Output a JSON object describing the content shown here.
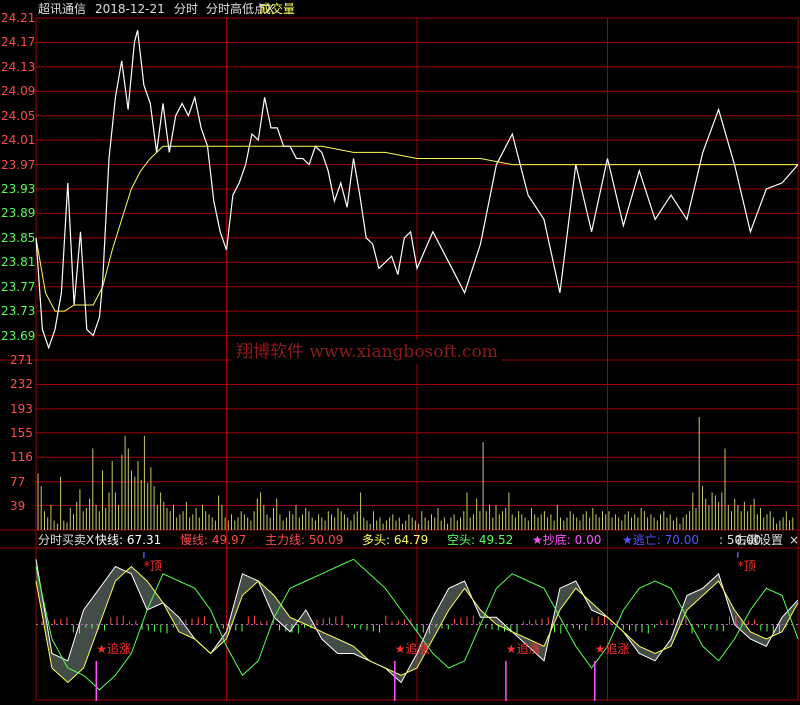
{
  "header": {
    "stock_name": "超讯通信",
    "date": "2018-12-21",
    "mode": "分时",
    "indicator": "分时高低点X",
    "volume_label": "成交量"
  },
  "watermark": "翔博软件 www.xiangbosoft.com",
  "indicator_bar": {
    "name": "分时买卖X",
    "items": [
      {
        "label": "快线:",
        "value": "67.31",
        "color": "#ffffff"
      },
      {
        "label": "慢线:",
        "value": "49.97",
        "color": "#ff4a4a"
      },
      {
        "label": "主力线:",
        "value": "50.09",
        "color": "#ff4a4a"
      },
      {
        "label": "多头:",
        "value": "64.79",
        "color": "#ffff54"
      },
      {
        "label": "空头:",
        "value": "49.52",
        "color": "#54ff54"
      },
      {
        "label": "★抄底:",
        "value": "0.00",
        "color": "#ff54ff"
      },
      {
        "label": "★逃亡:",
        "value": "70.00",
        "color": "#5454ff"
      },
      {
        "label": ":",
        "value": "50.00",
        "color": "#e0e0e0"
      }
    ],
    "settings_label": "右键设置",
    "close_label": "×"
  },
  "colors": {
    "grid": "#a00000",
    "price_line": "#ffffff",
    "avg_line": "#ffff54",
    "volume": "#c8c864",
    "up_label": "#ff4a4a",
    "down_label": "#54ff54",
    "signal_text": "#ff3030"
  },
  "chart_data": [
    {
      "type": "line",
      "panel": "price",
      "y_ticks": [
        "24.21",
        "24.17",
        "24.13",
        "24.09",
        "24.05",
        "24.01",
        "23.97",
        "23.93",
        "23.89",
        "23.85",
        "23.81",
        "23.77",
        "23.73",
        "23.69"
      ],
      "ylim": [
        23.65,
        24.21
      ],
      "series": [
        {
          "x": [
            0,
            2,
            4,
            6,
            8,
            10,
            12,
            14,
            16,
            18,
            20,
            21,
            23,
            25,
            27,
            29,
            31,
            32,
            34,
            36,
            38,
            40,
            42,
            44,
            46,
            48,
            50,
            52,
            54,
            56,
            58,
            60,
            62,
            64,
            66,
            68,
            70,
            72,
            74,
            76,
            78,
            80,
            82,
            84,
            86,
            88,
            90,
            92,
            94,
            96,
            98,
            100,
            102,
            104,
            106,
            108,
            110,
            112,
            114,
            116,
            118,
            120,
            125,
            130,
            135,
            140,
            145,
            150,
            155,
            160,
            165,
            170,
            175,
            180,
            185,
            190,
            195,
            200,
            205,
            210,
            215,
            220,
            225,
            230,
            235,
            240
          ],
          "values": [
            23.85,
            23.7,
            23.67,
            23.7,
            23.76,
            23.94,
            23.74,
            23.86,
            23.7,
            23.69,
            23.72,
            23.78,
            23.98,
            24.08,
            24.14,
            24.06,
            24.17,
            24.19,
            24.1,
            24.07,
            23.99,
            24.07,
            23.99,
            24.05,
            24.07,
            24.05,
            24.08,
            24.03,
            24.0,
            23.91,
            23.86,
            23.83,
            23.92,
            23.94,
            23.97,
            24.02,
            24.01,
            24.08,
            24.03,
            24.03,
            24.0,
            24.0,
            23.98,
            23.98,
            23.97,
            24.0,
            23.99,
            23.96,
            23.91,
            23.94,
            23.9,
            23.98,
            23.92,
            23.85,
            23.84,
            23.8,
            23.81,
            23.82,
            23.79,
            23.85,
            23.86,
            23.8,
            23.86,
            23.81,
            23.76,
            23.84,
            23.97,
            24.02,
            23.92,
            23.88,
            23.76,
            23.97,
            23.86,
            23.98,
            23.87,
            23.96,
            23.88,
            23.92,
            23.88,
            23.99,
            24.06,
            23.97,
            23.86,
            23.93,
            23.94,
            23.97
          ]
        },
        {
          "x": [
            0,
            3,
            6,
            9,
            12,
            15,
            18,
            21,
            24,
            27,
            30,
            33,
            36,
            40,
            45,
            50,
            60,
            70,
            80,
            90,
            100,
            110,
            120,
            130,
            140,
            150,
            160,
            170,
            180,
            190,
            200,
            210,
            220,
            230,
            240
          ],
          "values": [
            23.85,
            23.76,
            23.73,
            23.73,
            23.74,
            23.74,
            23.74,
            23.77,
            23.83,
            23.88,
            23.93,
            23.96,
            23.98,
            24.0,
            24.0,
            24.0,
            24.0,
            24.0,
            24.0,
            24.0,
            23.99,
            23.99,
            23.98,
            23.98,
            23.98,
            23.97,
            23.97,
            23.97,
            23.97,
            23.97,
            23.97,
            23.97,
            23.97,
            23.97,
            23.97
          ]
        }
      ]
    },
    {
      "type": "bar",
      "panel": "volume",
      "y_ticks": [
        "271",
        "232",
        "193",
        "155",
        "116",
        "77",
        "39"
      ],
      "ylim": [
        0,
        271
      ],
      "values": [
        90,
        70,
        30,
        20,
        40,
        15,
        10,
        85,
        15,
        12,
        35,
        25,
        45,
        65,
        30,
        35,
        50,
        130,
        40,
        30,
        95,
        35,
        60,
        110,
        60,
        40,
        120,
        150,
        130,
        95,
        85,
        110,
        80,
        150,
        75,
        100,
        70,
        40,
        60,
        45,
        35,
        30,
        40,
        20,
        25,
        30,
        45,
        20,
        25,
        35,
        20,
        40,
        30,
        25,
        20,
        15,
        55,
        40,
        20,
        15,
        25,
        15,
        20,
        30,
        25,
        20,
        15,
        30,
        50,
        60,
        40,
        25,
        20,
        35,
        50,
        25,
        15,
        20,
        30,
        25,
        40,
        20,
        25,
        35,
        30,
        20,
        15,
        25,
        20,
        15,
        30,
        25,
        20,
        35,
        30,
        25,
        20,
        15,
        25,
        30,
        60,
        20,
        15,
        10,
        30,
        15,
        20,
        10,
        15,
        20,
        25,
        15,
        20,
        10,
        15,
        25,
        20,
        15,
        10,
        30,
        20,
        15,
        25,
        20,
        35,
        15,
        20,
        10,
        20,
        25,
        15,
        20,
        30,
        60,
        20,
        25,
        50,
        30,
        140,
        30,
        40,
        20,
        40,
        25,
        30,
        35,
        60,
        25,
        20,
        30,
        25,
        20,
        15,
        35,
        25,
        20,
        25,
        30,
        20,
        25,
        15,
        40,
        20,
        15,
        20,
        30,
        25,
        20,
        15,
        25,
        30,
        20,
        35,
        25,
        20,
        30,
        25,
        30,
        20,
        25,
        20,
        15,
        25,
        30,
        20,
        25,
        20,
        35,
        30,
        20,
        25,
        20,
        15,
        25,
        30,
        20,
        25,
        15,
        20,
        10,
        20,
        25,
        30,
        60,
        35,
        180,
        70,
        50,
        40,
        60,
        55,
        45,
        60,
        130,
        40,
        30,
        50,
        40,
        30,
        45,
        30,
        40,
        50,
        25,
        35,
        20,
        25,
        30,
        20,
        10,
        15,
        20,
        30,
        15,
        20
      ]
    },
    {
      "type": "line",
      "panel": "indicator",
      "ylim": [
        0,
        100
      ],
      "series": [
        {
          "x": [
            0,
            5,
            10,
            15,
            20,
            25,
            30,
            35,
            40,
            45,
            50,
            55,
            60,
            65,
            70,
            75,
            80,
            85,
            90,
            95,
            100,
            105,
            110,
            115,
            120,
            125,
            130,
            135,
            140,
            145,
            150,
            155,
            160,
            165,
            170,
            175,
            180,
            185,
            190,
            195,
            200,
            205,
            210,
            215,
            220,
            225,
            230,
            235,
            240
          ],
          "values": [
            95,
            30,
            25,
            60,
            75,
            90,
            85,
            60,
            65,
            55,
            40,
            30,
            45,
            85,
            80,
            55,
            45,
            60,
            40,
            30,
            30,
            25,
            20,
            10,
            30,
            55,
            75,
            80,
            55,
            55,
            45,
            35,
            25,
            75,
            80,
            60,
            55,
            45,
            30,
            25,
            40,
            70,
            75,
            85,
            50,
            40,
            35,
            55,
            67
          ]
        },
        {
          "x": [
            0,
            5,
            10,
            15,
            20,
            25,
            30,
            35,
            40,
            45,
            50,
            55,
            60,
            65,
            70,
            75,
            80,
            85,
            90,
            95,
            100,
            105,
            110,
            115,
            120,
            125,
            130,
            135,
            140,
            145,
            150,
            155,
            160,
            165,
            170,
            175,
            180,
            185,
            190,
            195,
            200,
            205,
            210,
            215,
            220,
            225,
            230,
            235,
            240
          ],
          "values": [
            80,
            20,
            10,
            20,
            50,
            80,
            90,
            80,
            65,
            45,
            40,
            30,
            40,
            70,
            80,
            70,
            55,
            50,
            45,
            40,
            35,
            25,
            20,
            15,
            20,
            40,
            60,
            75,
            60,
            50,
            45,
            40,
            35,
            60,
            75,
            65,
            55,
            45,
            35,
            30,
            35,
            60,
            70,
            80,
            60,
            45,
            40,
            45,
            65
          ]
        },
        {
          "x": [
            0,
            5,
            10,
            15,
            20,
            25,
            30,
            35,
            40,
            45,
            50,
            55,
            60,
            65,
            70,
            75,
            80,
            85,
            90,
            95,
            100,
            105,
            110,
            115,
            120,
            125,
            130,
            135,
            140,
            145,
            150,
            155,
            160,
            165,
            170,
            175,
            180,
            185,
            190,
            195,
            200,
            205,
            210,
            215,
            220,
            225,
            230,
            235,
            240
          ],
          "values": [
            90,
            40,
            20,
            15,
            5,
            15,
            30,
            60,
            85,
            80,
            75,
            60,
            35,
            15,
            25,
            55,
            75,
            80,
            85,
            90,
            95,
            85,
            75,
            60,
            45,
            30,
            20,
            25,
            50,
            75,
            85,
            80,
            75,
            55,
            35,
            20,
            35,
            60,
            75,
            80,
            75,
            55,
            35,
            25,
            40,
            60,
            75,
            70,
            40
          ]
        }
      ],
      "signals": [
        {
          "label": "*顶",
          "x": 34
        },
        {
          "label": "★追涨",
          "x": 19
        },
        {
          "label": "★追涨",
          "x": 113
        },
        {
          "label": "★追涨",
          "x": 148
        },
        {
          "label": "★追涨",
          "x": 176
        },
        {
          "label": "*顶",
          "x": 221
        }
      ]
    }
  ]
}
